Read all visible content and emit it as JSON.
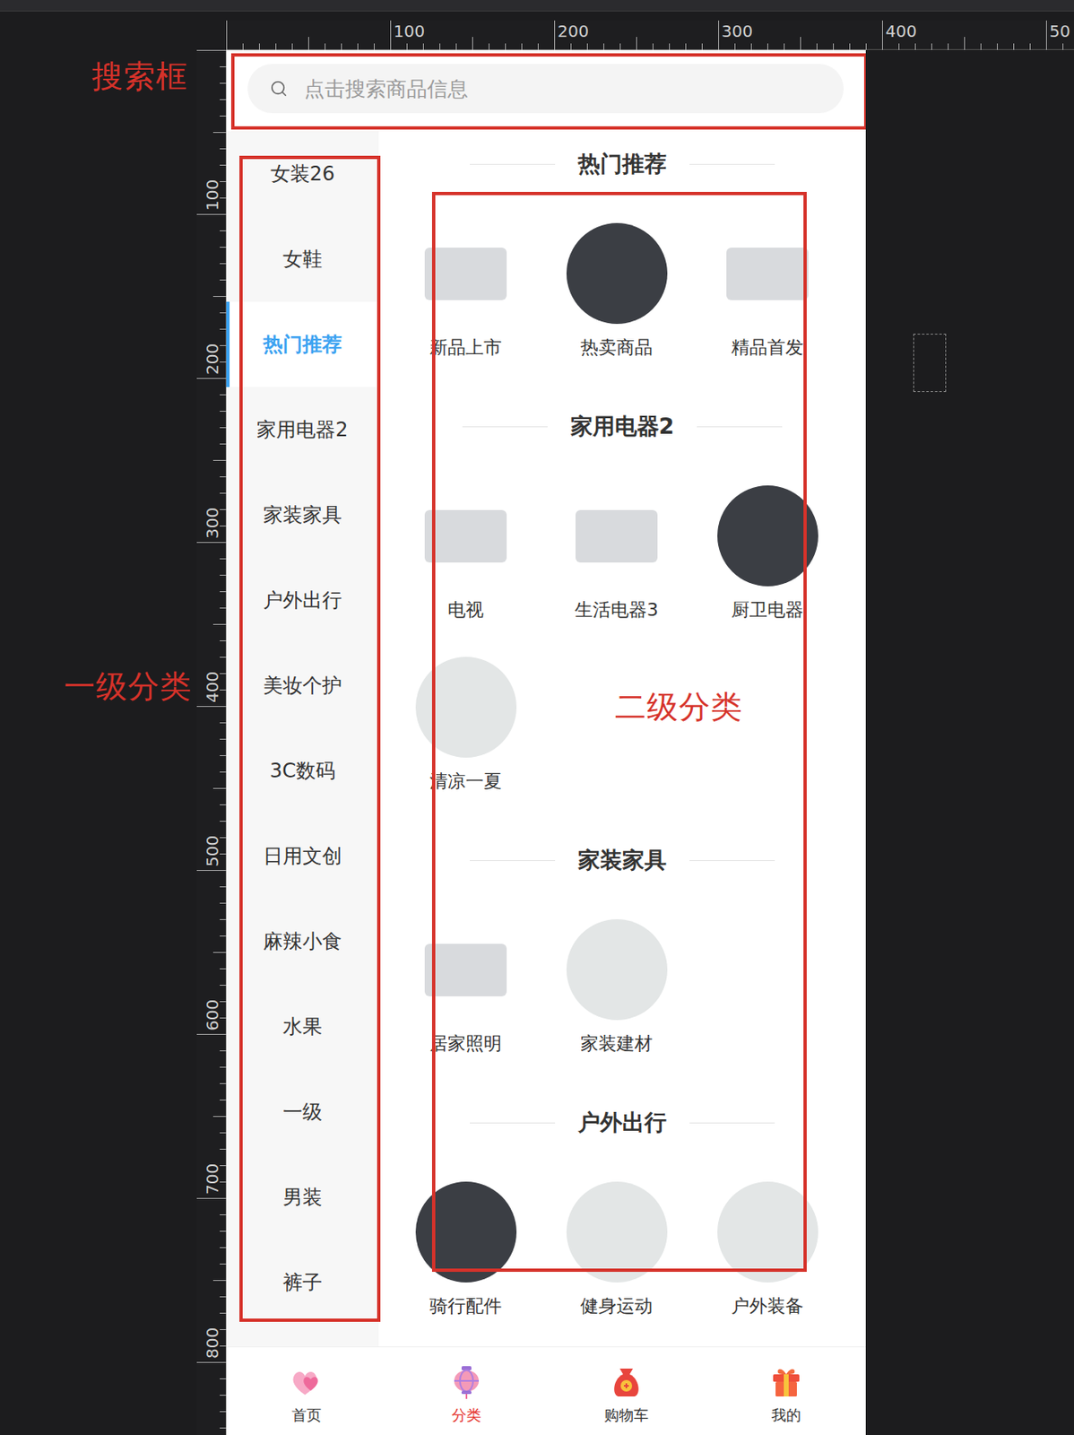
{
  "rulers": {
    "top": [
      "100",
      "200",
      "300",
      "400",
      "50"
    ],
    "left": [
      "100",
      "200",
      "300",
      "400",
      "500",
      "600",
      "700",
      "800"
    ]
  },
  "annotations": {
    "search": "搜索框",
    "primary": "一级分类",
    "secondary": "二级分类"
  },
  "search": {
    "placeholder": "点击搜索商品信息"
  },
  "categories": [
    {
      "label": "女装26",
      "selected": false
    },
    {
      "label": "女鞋",
      "selected": false
    },
    {
      "label": "热门推荐",
      "selected": true
    },
    {
      "label": "家用电器2",
      "selected": false
    },
    {
      "label": "家装家具",
      "selected": false
    },
    {
      "label": "户外出行",
      "selected": false
    },
    {
      "label": "美妆个护",
      "selected": false
    },
    {
      "label": "3C数码",
      "selected": false
    },
    {
      "label": "日用文创",
      "selected": false
    },
    {
      "label": "麻辣小食",
      "selected": false
    },
    {
      "label": "水果",
      "selected": false
    },
    {
      "label": "一级",
      "selected": false
    },
    {
      "label": "男装",
      "selected": false
    },
    {
      "label": "裤子",
      "selected": false
    }
  ],
  "sections": [
    {
      "title": "热门推荐",
      "items": [
        {
          "label": "新品上市",
          "kind": "cutout"
        },
        {
          "label": "热卖商品",
          "kind": "dark"
        },
        {
          "label": "精品首发",
          "kind": "cutout"
        }
      ]
    },
    {
      "title": "家用电器2",
      "items": [
        {
          "label": "电视",
          "kind": "cutout"
        },
        {
          "label": "生活电器3",
          "kind": "cutout"
        },
        {
          "label": "厨卫电器",
          "kind": "dark"
        },
        {
          "label": "清凉一夏",
          "kind": "light"
        }
      ]
    },
    {
      "title": "家装家具",
      "items": [
        {
          "label": "居家照明",
          "kind": "cutout"
        },
        {
          "label": "家装建材",
          "kind": "light"
        }
      ]
    },
    {
      "title": "户外出行",
      "items": [
        {
          "label": "骑行配件",
          "kind": "dark"
        },
        {
          "label": "健身运动",
          "kind": "light"
        },
        {
          "label": "户外装备",
          "kind": "light"
        }
      ]
    }
  ],
  "nav": [
    {
      "label": "首页",
      "selected": false
    },
    {
      "label": "分类",
      "selected": true
    },
    {
      "label": "购物车",
      "selected": false
    },
    {
      "label": "我的",
      "selected": false
    }
  ]
}
